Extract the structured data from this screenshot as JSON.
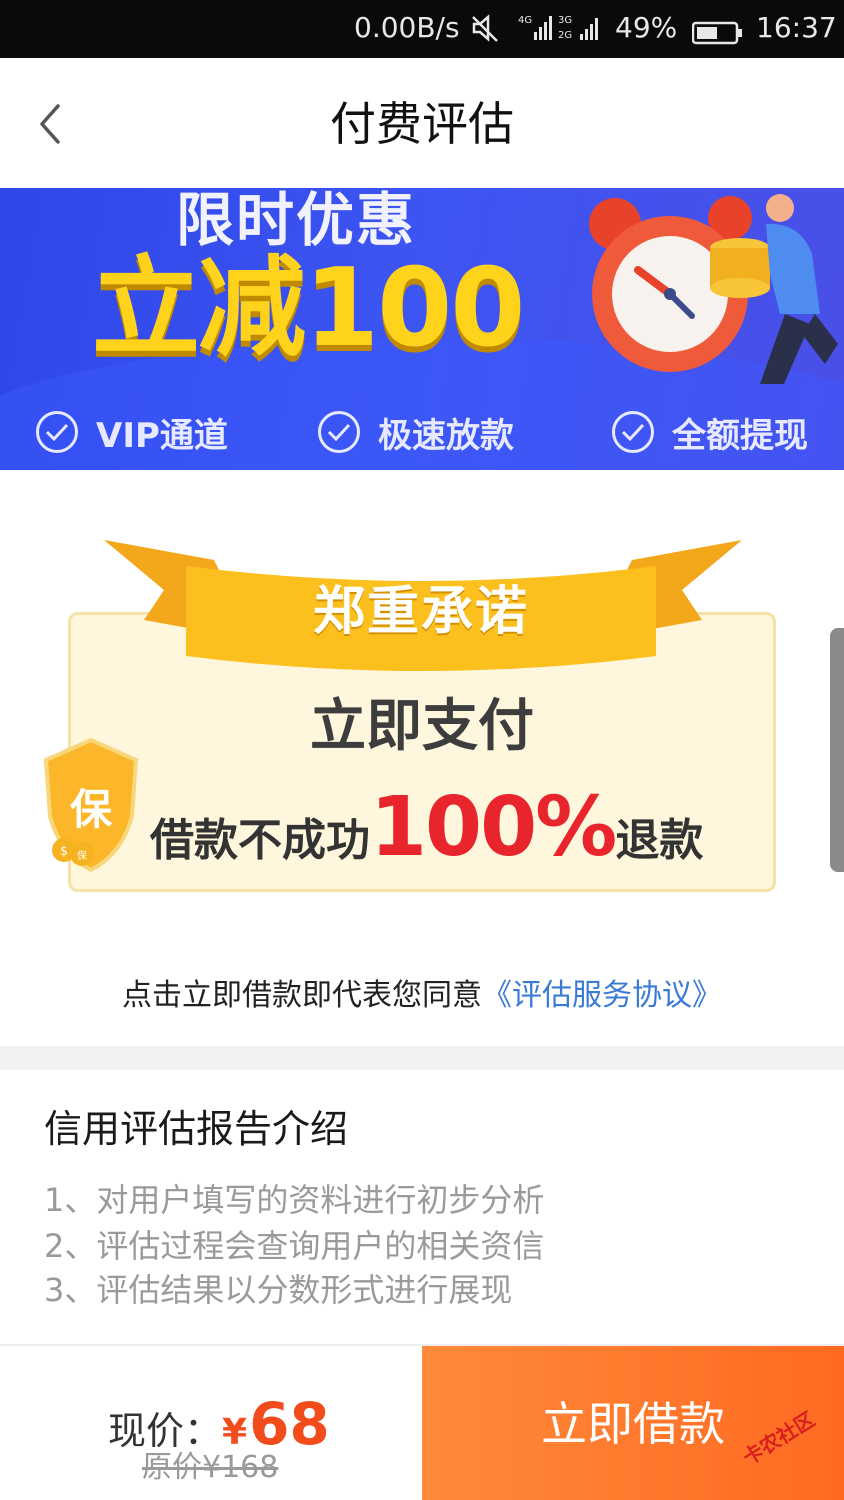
{
  "status_bar": {
    "speed": "0.00B/s",
    "net1": "4G",
    "net2": "3G 2G",
    "battery_pct": "49%",
    "time": "16:37"
  },
  "header": {
    "title": "付费评估"
  },
  "banner": {
    "limited": "限时优惠",
    "discount": "立减100",
    "features": [
      "VIP通道",
      "极速放款",
      "全额提现"
    ]
  },
  "promise": {
    "title": "郑重承诺",
    "pay": "立即支付",
    "refund_pre": "借款不成功",
    "refund_num": "100%",
    "refund_post": "退款",
    "shield_char": "保",
    "coin_dollar": "$",
    "coin_bao": "保"
  },
  "agreement": {
    "text": "点击立即借款即代表您同意",
    "link": "《评估服务协议》"
  },
  "intro": {
    "title": "信用评估报告介绍",
    "items": [
      "1、对用户填写的资料进行初步分析",
      "2、评估过程会查询用户的相关资信",
      "3、评估结果以分数形式进行展现"
    ]
  },
  "bottom": {
    "now_label": "现价：",
    "currency": "¥",
    "now_value": "68",
    "original": "原价¥168",
    "button": "立即借款",
    "watermark": "卡农社区"
  },
  "colors": {
    "banner": "#3d55f2",
    "gold": "#ffd21c",
    "red": "#e8242c",
    "orange": "#ff6a22",
    "link": "#3a7bd5"
  }
}
